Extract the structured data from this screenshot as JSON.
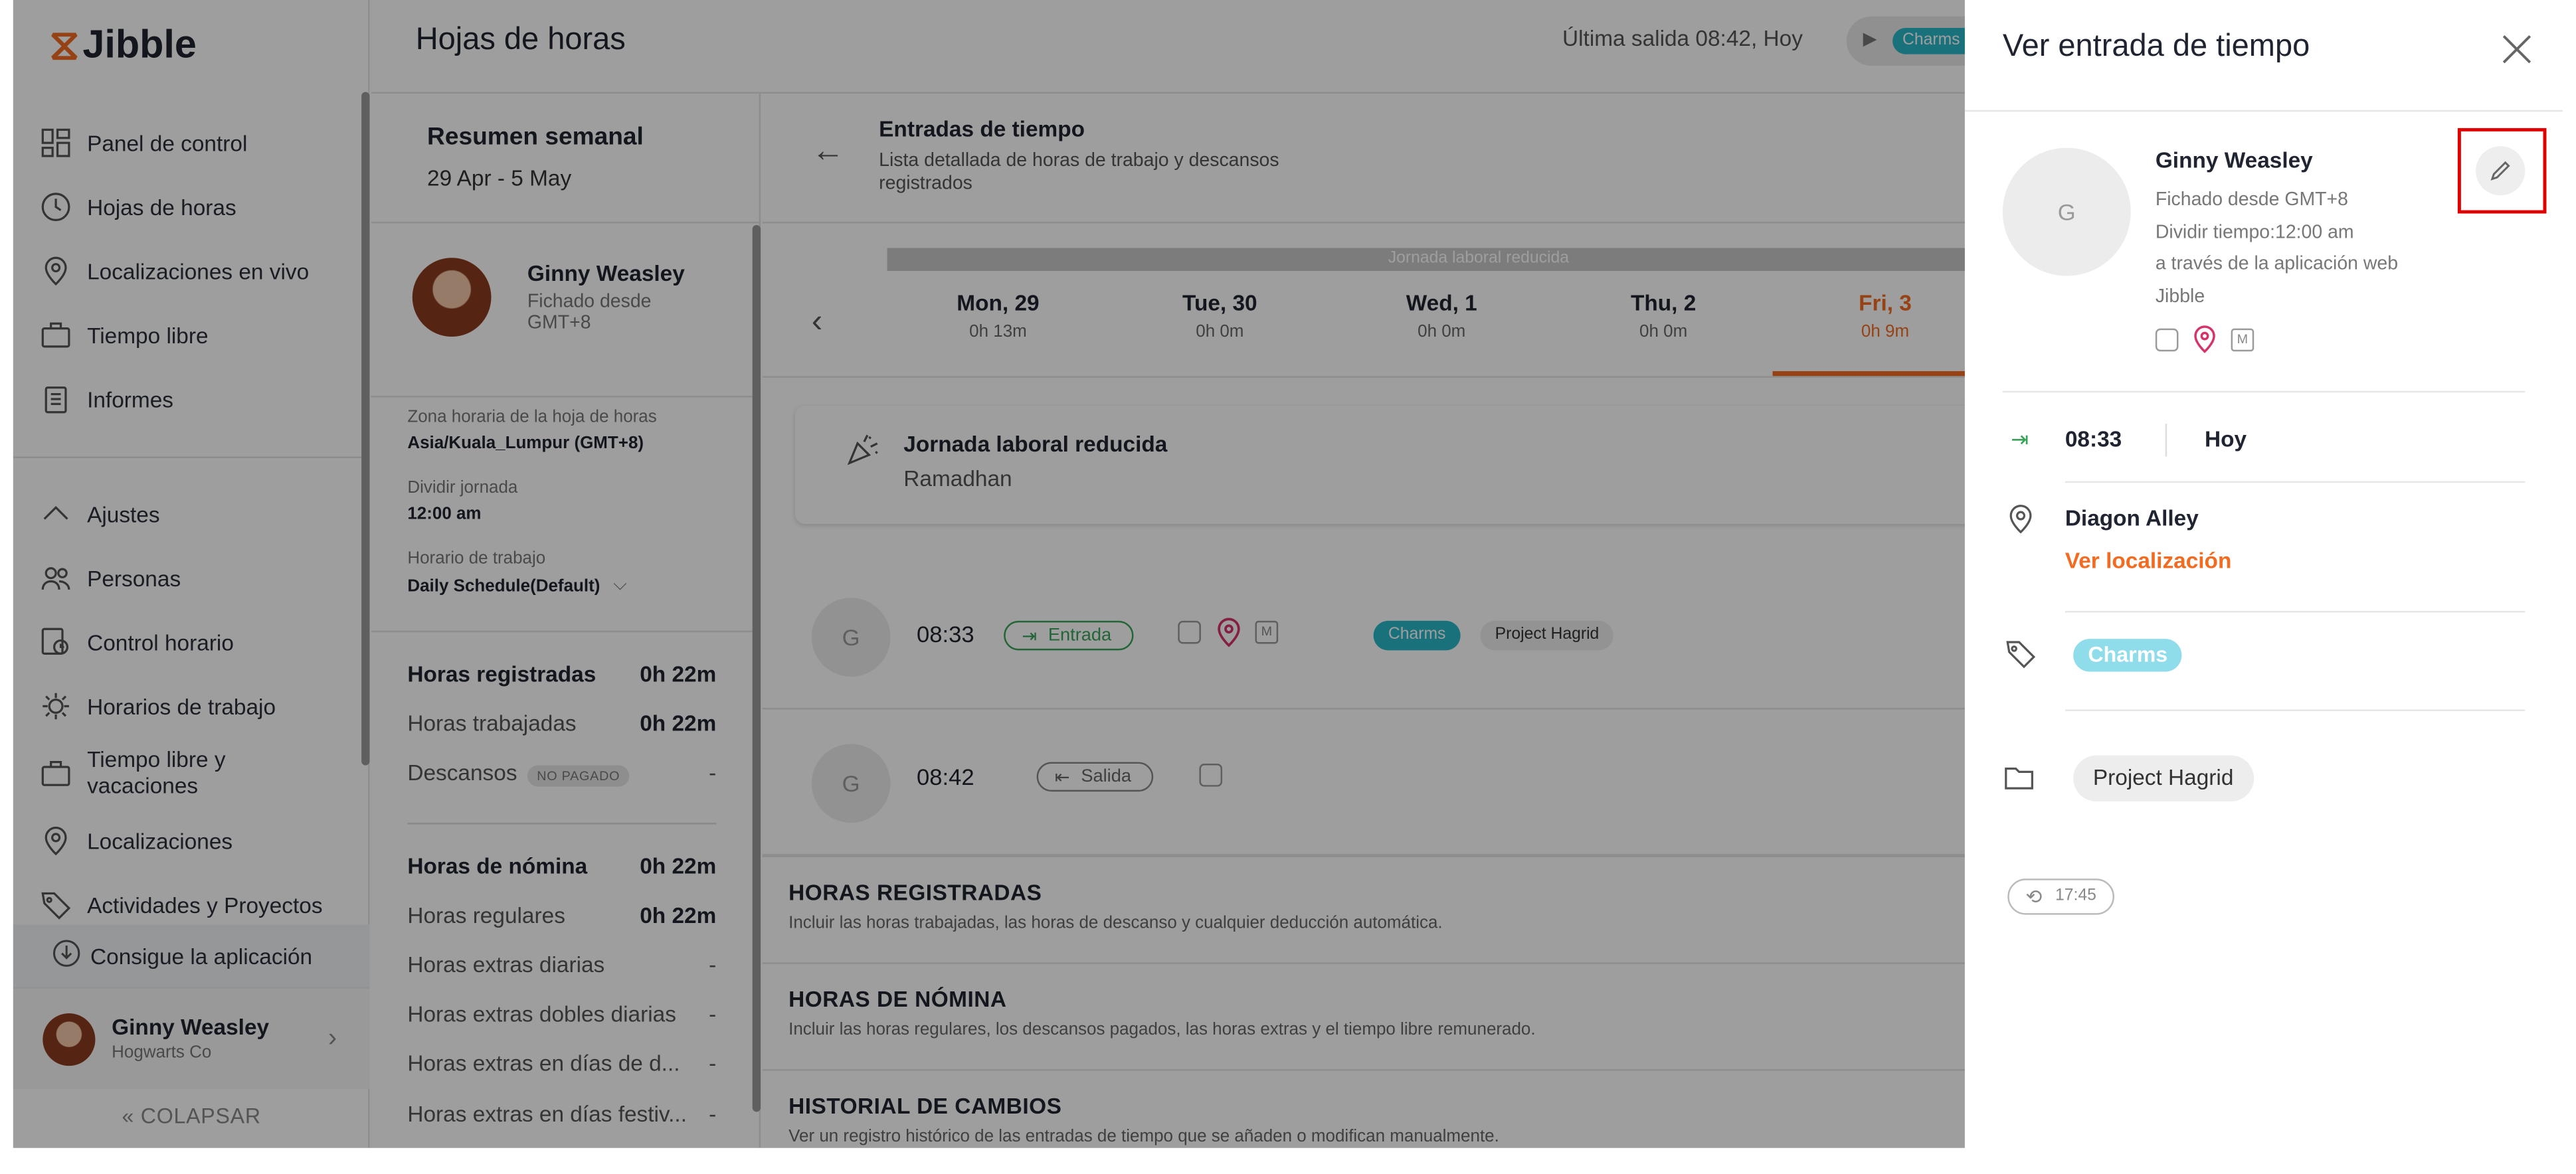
{
  "app": {
    "logo": "Jibble",
    "nav": [
      {
        "label": "Panel de control",
        "icon": "dashboard-icon"
      },
      {
        "label": "Hojas de horas",
        "icon": "clock-icon"
      },
      {
        "label": "Localizaciones en vivo",
        "icon": "pin-icon"
      },
      {
        "label": "Tiempo libre",
        "icon": "briefcase-icon"
      },
      {
        "label": "Informes",
        "icon": "clipboard-icon"
      }
    ],
    "settings_label": "Ajustes",
    "settings_nav": [
      {
        "label": "Personas",
        "icon": "people-icon"
      },
      {
        "label": "Control horario",
        "icon": "time-tracking-icon"
      },
      {
        "label": "Horarios de trabajo",
        "icon": "schedule-icon"
      },
      {
        "label": "Tiempo libre y vacaciones",
        "icon": "briefcase-icon"
      },
      {
        "label": "Localizaciones",
        "icon": "pin-icon"
      },
      {
        "label": "Actividades y Proyectos",
        "icon": "tag-icon"
      }
    ],
    "get_app": "Consigue la aplicación",
    "user": {
      "name": "Ginny Weasley",
      "org": "Hogwarts Co"
    },
    "collapse": "COLAPSAR"
  },
  "header": {
    "title": "Hojas de horas",
    "last_out": "Última salida 08:42, Hoy",
    "timer_tag": "Charms"
  },
  "weekly": {
    "title": "Resumen semanal",
    "range": "29 Apr - 5 May",
    "person": {
      "name": "Ginny Weasley",
      "sub": "Fichado desde GMT+8"
    },
    "timezone_label": "Zona horaria de la hoja de horas",
    "timezone_value": "Asia/Kuala_Lumpur (GMT+8)",
    "split_label": "Dividir jornada",
    "split_value": "12:00 am",
    "schedule_label": "Horario de trabajo",
    "schedule_value": "Daily Schedule(Default)",
    "tracked": [
      {
        "label": "Horas registradas",
        "value": "0h 22m"
      },
      {
        "label": "Horas trabajadas",
        "value": "0h 22m"
      },
      {
        "label": "Descansos",
        "badge": "NO PAGADO",
        "value": "-"
      }
    ],
    "payroll": [
      {
        "label": "Horas de nómina",
        "value": "0h 22m"
      },
      {
        "label": "Horas regulares",
        "value": "0h 22m"
      },
      {
        "label": "Horas extras diarias",
        "value": "-"
      },
      {
        "label": "Horas extras dobles diarias",
        "value": "-"
      },
      {
        "label": "Horas extras en días de d...",
        "value": "-"
      },
      {
        "label": "Horas extras en días festiv...",
        "value": "-"
      }
    ]
  },
  "entries": {
    "title": "Entradas de tiempo",
    "subtitle": "Lista detallada de horas de trabajo y descansos registrados",
    "reduced_banner": "Jornada laboral reducida",
    "days": [
      {
        "name": "Mon, 29",
        "hours": "0h 13m"
      },
      {
        "name": "Tue, 30",
        "hours": "0h 0m"
      },
      {
        "name": "Wed, 1",
        "hours": "0h 0m"
      },
      {
        "name": "Thu, 2",
        "hours": "0h 0m"
      },
      {
        "name": "Fri, 3",
        "hours": "0h 9m"
      }
    ],
    "reduced_card": {
      "title": "Jornada laboral reducida",
      "subtitle": "Ramadhan"
    },
    "rows": [
      {
        "avatar": "G",
        "time": "08:33",
        "type": "Entrada",
        "activity": "Charms",
        "project": "Project Hagrid"
      },
      {
        "avatar": "G",
        "time": "08:42",
        "type": "Salida"
      }
    ],
    "sections": [
      {
        "title": "HORAS REGISTRADAS",
        "subtitle": "Incluir las horas trabajadas, las horas de descanso y cualquier deducción automática."
      },
      {
        "title": "HORAS DE NÓMINA",
        "subtitle": "Incluir las horas regulares, los descansos pagados, las horas extras y el tiempo libre remunerado."
      },
      {
        "title": "HISTORIAL DE CAMBIOS",
        "subtitle": "Ver un registro histórico de las entradas de tiempo que se añaden o modifican manualmente."
      }
    ]
  },
  "drawer": {
    "title": "Ver entrada de tiempo",
    "avatar": "G",
    "name": "Ginny Weasley",
    "meta_timezone": "Fichado desde GMT+8",
    "meta_split": "Dividir tiempo:12:00 am",
    "meta_via": "a través de la aplicación web Jibble",
    "time": "08:33",
    "day": "Hoy",
    "location": "Diagon Alley",
    "location_link": "Ver localización",
    "activity": "Charms",
    "project": "Project Hagrid",
    "stamp": "17:45"
  },
  "colors": {
    "accent": "#f26b21",
    "activity": "#29b6c8",
    "clock_in": "#3aa35a",
    "highlight": "#e00000"
  }
}
